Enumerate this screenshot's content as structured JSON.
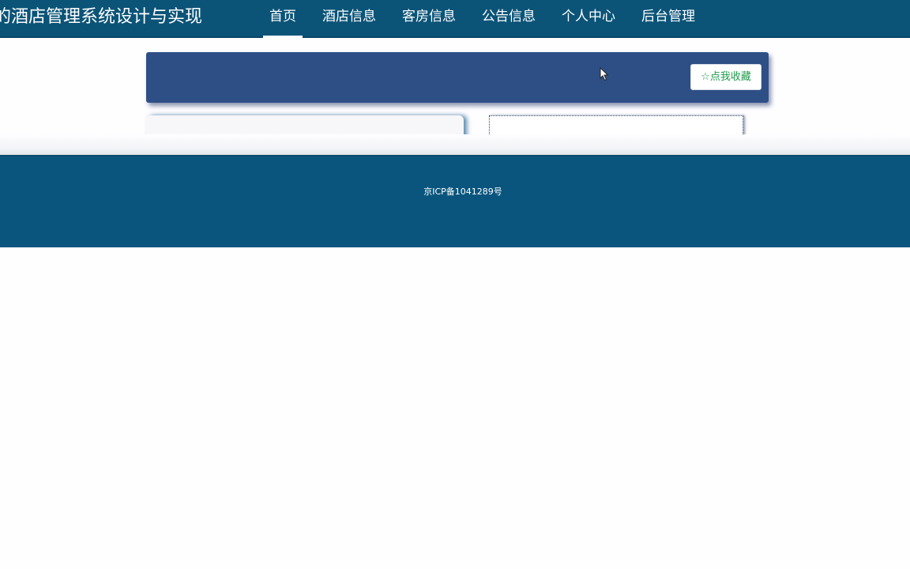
{
  "header": {
    "site_title": "的酒店管理系统设计与实现",
    "nav": [
      {
        "label": "首页",
        "active": true
      },
      {
        "label": "酒店信息"
      },
      {
        "label": "客房信息"
      },
      {
        "label": "公告信息"
      },
      {
        "label": "个人中心"
      },
      {
        "label": "后台管理"
      }
    ]
  },
  "banner": {
    "favorite_button": "☆点我收藏"
  },
  "footer": {
    "icp": "京ICP备1041289号"
  },
  "colors": {
    "header_bg": "#0b5478",
    "banner_bg": "#2e4f85",
    "footer_bg": "#09557d",
    "favorite_text": "#1d9a4a"
  },
  "icons": {
    "cursor": "mouse-pointer-icon",
    "favorite": "star-outline-icon"
  }
}
